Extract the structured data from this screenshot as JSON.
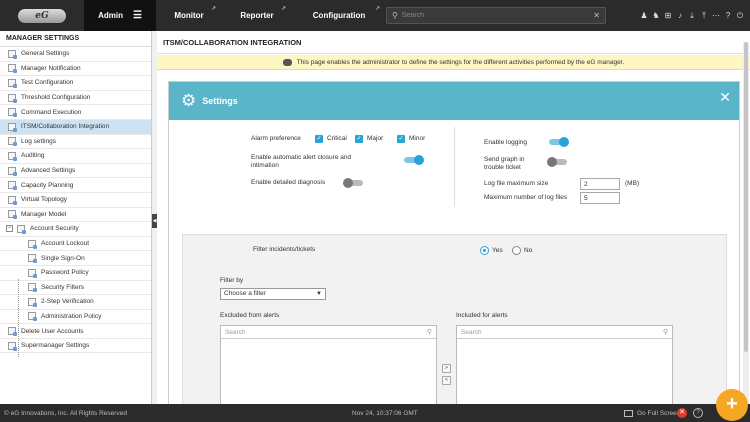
{
  "topbar": {
    "logo_text": "eG",
    "tabs": [
      {
        "label": "Admin"
      },
      {
        "label": "Monitor"
      },
      {
        "label": "Reporter"
      },
      {
        "label": "Configuration"
      }
    ],
    "search_placeholder": "Search",
    "icons": [
      "user-icon",
      "users-icon",
      "sitemap-icon",
      "bell-icon",
      "download-icon",
      "upload-icon",
      "more-icon",
      "help-icon",
      "power-icon"
    ]
  },
  "sidebar": {
    "title": "MANAGER SETTINGS",
    "items": [
      {
        "label": "General Settings"
      },
      {
        "label": "Manager Notification"
      },
      {
        "label": "Test Configuration"
      },
      {
        "label": "Threshold Configuration"
      },
      {
        "label": "Command Execution"
      },
      {
        "label": "ITSM/Collaboration Integration"
      },
      {
        "label": "Log settings"
      },
      {
        "label": "Auditing"
      },
      {
        "label": "Advanced Settings"
      },
      {
        "label": "Capacity Planning"
      },
      {
        "label": "Virtual Topology"
      },
      {
        "label": "Manager Model"
      },
      {
        "label": "Account Security"
      },
      {
        "label": "Account Lockout"
      },
      {
        "label": "Single Sign-On"
      },
      {
        "label": "Password Policy"
      },
      {
        "label": "Security Filters"
      },
      {
        "label": "2-Step Verification"
      },
      {
        "label": "Administration Policy"
      },
      {
        "label": "Delete User Accounts"
      },
      {
        "label": "Supermanager Settings"
      }
    ],
    "active_index": 5
  },
  "main": {
    "title": "ITSM/COLLABORATION INTEGRATION",
    "info": "This page enables the administrator to define the settings for the different activities performed by the eG manager.",
    "panel": {
      "title": "Settings",
      "alarm_pref_label": "Alarm preference",
      "alarm_critical": "Critical",
      "alarm_major": "Major",
      "alarm_minor": "Minor",
      "auto_closure_label": "Enable automatic alert closure and intimation",
      "detailed_diag_label": "Enable detailed diagnosis",
      "enable_logging_label": "Enable logging",
      "send_graph_label": "Send graph in trouble ticket",
      "log_max_size_label": "Log file maximum size",
      "log_max_size_value": "2",
      "log_max_size_unit": "(MB)",
      "max_log_files_label": "Maximum number of log files",
      "max_log_files_value": "5",
      "toggles": {
        "auto_closure": true,
        "detailed_diag": false,
        "enable_logging": true,
        "send_graph": false
      },
      "filter_incidents_label": "Filter incidents/tickets",
      "filter_yes": "Yes",
      "filter_no": "No",
      "filter_by_label": "Filter by",
      "filter_select_value": "Choose a filter",
      "excluded_label": "Excluded from alerts",
      "included_label": "Included for alerts",
      "list_search_placeholder": "Search"
    }
  },
  "footer": {
    "copyright": "© eG Innovations, Inc. All Rights Reserved",
    "timestamp": "Nov 24, 10:37:06 GMT",
    "fullscreen": "Go Full Screen"
  },
  "colors": {
    "accent": "#5bb5c8",
    "checkbox": "#2aa3d8",
    "fab": "#f5a623",
    "info_bar": "#fdf6c3"
  }
}
